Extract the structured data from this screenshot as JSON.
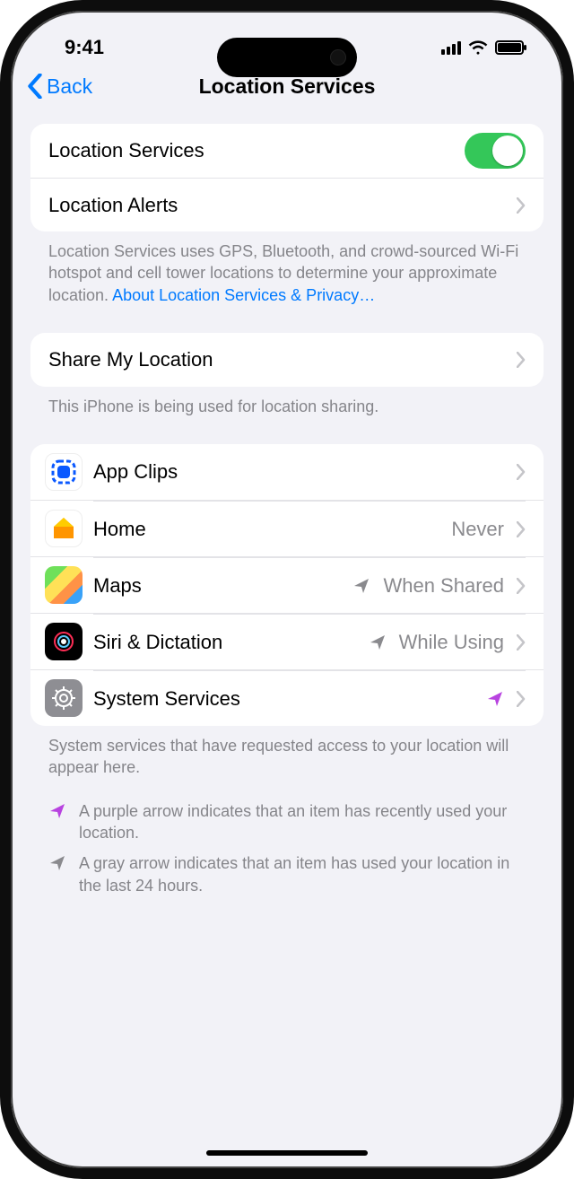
{
  "status": {
    "time": "9:41"
  },
  "nav": {
    "back": "Back",
    "title": "Location Services"
  },
  "sec1": {
    "row_services": "Location Services",
    "row_alerts": "Location Alerts"
  },
  "footer1": {
    "text": "Location Services uses GPS, Bluetooth, and crowd-sourced Wi-Fi hotspot and cell tower locations to determine your approximate location. ",
    "link": "About Location Services & Privacy…"
  },
  "sec2": {
    "row_share": "Share My Location"
  },
  "footer2": {
    "text": "This iPhone is being used for location sharing."
  },
  "apps": [
    {
      "label": "App Clips",
      "value": "",
      "arrow": "none"
    },
    {
      "label": "Home",
      "value": "Never",
      "arrow": "none"
    },
    {
      "label": "Maps",
      "value": "When Shared",
      "arrow": "gray"
    },
    {
      "label": "Siri & Dictation",
      "value": "While Using",
      "arrow": "gray"
    },
    {
      "label": "System Services",
      "value": "",
      "arrow": "purple"
    }
  ],
  "footer3": {
    "text": "System services that have requested access to your location will appear here."
  },
  "legend": {
    "purple": "A purple arrow indicates that an item has recently used your location.",
    "gray": "A gray arrow indicates that an item has used your location in the last 24 hours."
  }
}
